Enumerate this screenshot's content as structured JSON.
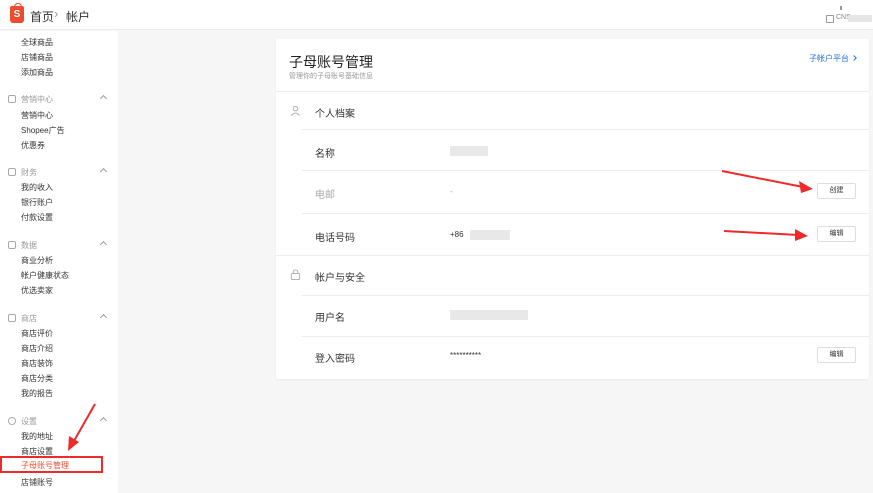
{
  "topbar": {
    "home_label": "首页",
    "separator": "›",
    "current_label": "帐户",
    "user_tag": "CNS"
  },
  "sidebar": {
    "product_items": [
      "全球商品",
      "店铺商品",
      "添加商品"
    ],
    "sections": [
      {
        "title": "营销中心",
        "icon": "tag-icon",
        "items": [
          "营销中心",
          "Shopee广告",
          "优惠券"
        ]
      },
      {
        "title": "财务",
        "icon": "wallet-icon",
        "items": [
          "我的收入",
          "银行账户",
          "付款设置"
        ]
      },
      {
        "title": "数据",
        "icon": "chart-icon",
        "items": [
          "商业分析",
          "帐户健康状态",
          "优选卖家"
        ]
      },
      {
        "title": "商店",
        "icon": "shop-icon",
        "items": [
          "商店评价",
          "商店介绍",
          "商店装饰",
          "商店分类",
          "我的报告"
        ]
      },
      {
        "title": "设置",
        "icon": "gear-icon",
        "items": [
          "我的地址",
          "商店设置",
          "子母账号管理",
          "店铺账号"
        ]
      }
    ],
    "active_item": "子母账号管理"
  },
  "card": {
    "title": "子母账号管理",
    "subtitle": "管理你的子母账号基础信息",
    "link_label": "子帐户平台",
    "profile": {
      "section_title": "个人档案",
      "name_label": "名称",
      "email_label": "电邮",
      "email_value": "-",
      "email_button": "创建",
      "phone_label": "电话号码",
      "phone_prefix": "+86",
      "phone_button": "编辑"
    },
    "security": {
      "section_title": "帐户与安全",
      "username_label": "用户名",
      "password_label": "登入密码",
      "password_value": "**********",
      "password_button": "编辑"
    }
  },
  "colors": {
    "brand": "#ee4d2d",
    "link": "#2673dd",
    "annotation": "#ee2a2a"
  }
}
